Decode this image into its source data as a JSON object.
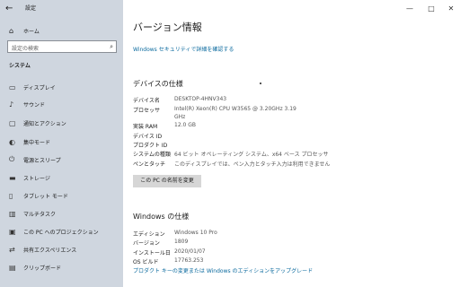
{
  "window": {
    "title": "設定",
    "back_icon": "arrow-left-icon",
    "controls": [
      "minimize",
      "maximize",
      "close"
    ]
  },
  "sidebar": {
    "home_label": "ホーム",
    "search_placeholder": "設定の検索",
    "section": "システム",
    "items": [
      {
        "label": "ディスプレイ",
        "icon": "display-icon"
      },
      {
        "label": "サウンド",
        "icon": "sound-icon"
      },
      {
        "label": "通知とアクション",
        "icon": "notification-icon"
      },
      {
        "label": "集中モード",
        "icon": "focus-icon"
      },
      {
        "label": "電源とスリープ",
        "icon": "power-icon"
      },
      {
        "label": "ストレージ",
        "icon": "storage-icon"
      },
      {
        "label": "タブレット モード",
        "icon": "tablet-icon"
      },
      {
        "label": "マルチタスク",
        "icon": "multitask-icon"
      },
      {
        "label": "この PC へのプロジェクション",
        "icon": "projection-icon"
      },
      {
        "label": "共有エクスペリエンス",
        "icon": "share-icon"
      },
      {
        "label": "クリップボード",
        "icon": "clipboard-icon"
      }
    ]
  },
  "main": {
    "title": "バージョン情報",
    "security_link": "Windows セキュリティで詳細を確認する",
    "device": {
      "heading": "デバイスの仕様",
      "rows": [
        {
          "k": "デバイス名",
          "v": "DESKTOP-4HNV343"
        },
        {
          "k": "プロセッサ",
          "v": "Intel(R) Xeon(R) CPU       W3565  @ 3.20GHz   3.19"
        },
        {
          "k": "",
          "v": "GHz"
        },
        {
          "k": "実装 RAM",
          "v": "12.0 GB"
        },
        {
          "k": "デバイス ID",
          "v": ""
        },
        {
          "k": "プロダクト ID",
          "v": ""
        },
        {
          "k": "システムの種類",
          "v": "64 ビット オペレーティング システム、x64 ベース プロセッサ"
        },
        {
          "k": "ペンとタッチ",
          "v": "このディスプレイでは、ペン入力とタッチ入力は利用できません"
        }
      ],
      "rename_button": "この PC の名前を変更"
    },
    "windows": {
      "heading": "Windows の仕様",
      "rows": [
        {
          "k": "エディション",
          "v": "Windows 10 Pro"
        },
        {
          "k": "バージョン",
          "v": "1809"
        },
        {
          "k": "インストール日",
          "v": "2020/01/07"
        },
        {
          "k": "OS ビルド",
          "v": "17763.253"
        }
      ],
      "upgrade_link": "プロダクト キーの変更または Windows のエディションをアップグレード"
    }
  },
  "colors": {
    "sidebar_bg": "#cfd6df",
    "link": "#0b6a9e",
    "button": "#d6d6d6"
  }
}
